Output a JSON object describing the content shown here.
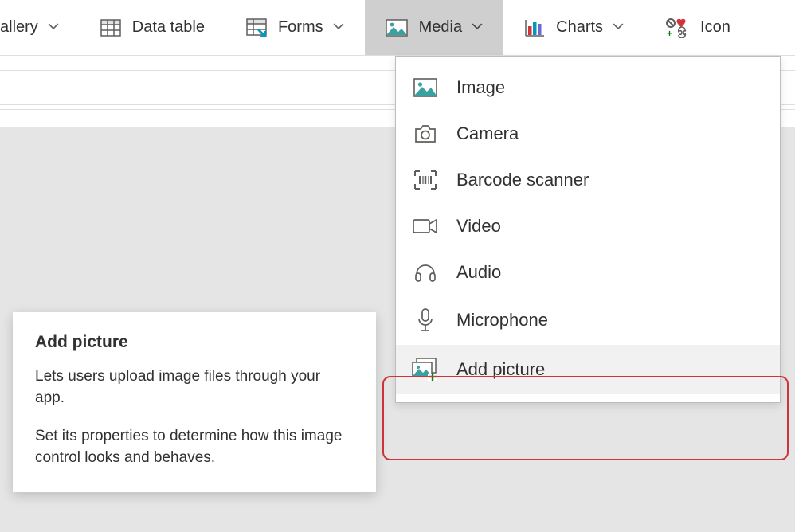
{
  "ribbon": {
    "gallery_label": "allery",
    "data_table_label": "Data table",
    "forms_label": "Forms",
    "media_label": "Media",
    "charts_label": "Charts",
    "icons_label": "Icon"
  },
  "media_menu": {
    "items": [
      {
        "id": "image",
        "label": "Image"
      },
      {
        "id": "camera",
        "label": "Camera"
      },
      {
        "id": "barcode",
        "label": "Barcode scanner"
      },
      {
        "id": "video",
        "label": "Video"
      },
      {
        "id": "audio",
        "label": "Audio"
      },
      {
        "id": "microphone",
        "label": "Microphone"
      },
      {
        "id": "add_picture",
        "label": "Add picture"
      }
    ]
  },
  "help": {
    "title": "Add picture",
    "body1": "Lets users upload image files through your app.",
    "body2": "Set its properties to determine how this image control looks and behaves."
  }
}
